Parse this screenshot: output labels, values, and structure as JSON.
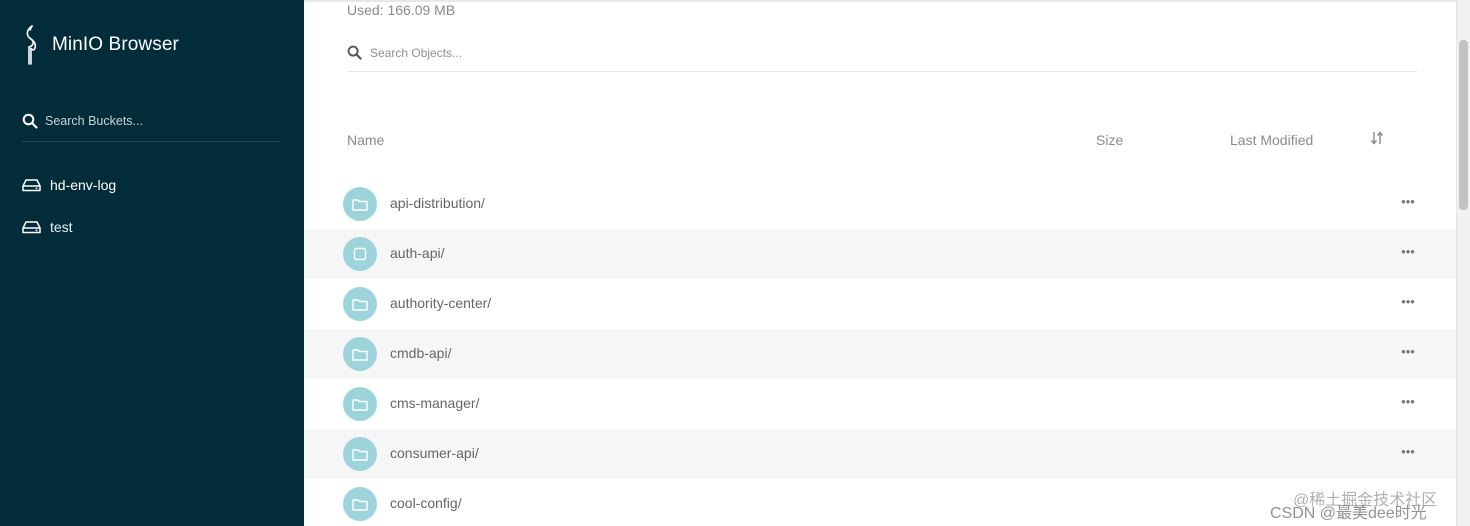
{
  "sidebar": {
    "brand": "MinIO Browser",
    "search_placeholder": "Search Buckets...",
    "buckets": [
      {
        "label": "hd-env-log",
        "active": true
      },
      {
        "label": "test",
        "active": false
      }
    ],
    "background": "#032c3b"
  },
  "main": {
    "used": "Used: 166.09 MB",
    "search_placeholder": "Search Objects...",
    "columns": {
      "name": "Name",
      "size": "Size",
      "last_modified": "Last Modified"
    },
    "objects": [
      {
        "name": "api-distribution/",
        "icon": "folder-icon"
      },
      {
        "name": "auth-api/",
        "icon": "square-icon"
      },
      {
        "name": "authority-center/",
        "icon": "folder-icon"
      },
      {
        "name": "cmdb-api/",
        "icon": "folder-icon"
      },
      {
        "name": "cms-manager/",
        "icon": "folder-icon"
      },
      {
        "name": "consumer-api/",
        "icon": "folder-icon"
      },
      {
        "name": "cool-config/",
        "icon": "folder-icon"
      }
    ],
    "more_label": "•••",
    "folder_color": "#9dd4dc"
  },
  "watermark": {
    "line1": "@稀土掘金技术社区",
    "line2": "CSDN @最美dee时光"
  }
}
